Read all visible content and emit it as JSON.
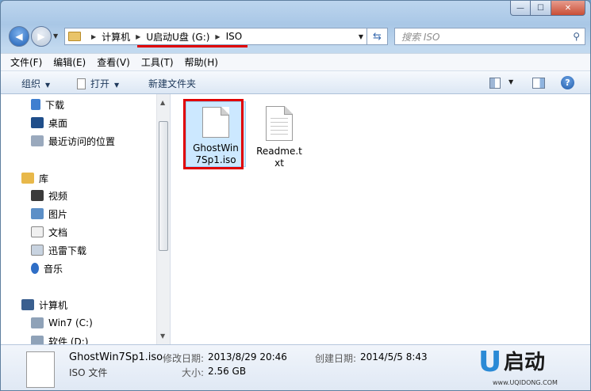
{
  "window": {
    "caption_min": "—",
    "caption_max": "☐",
    "caption_close": "✕"
  },
  "address": {
    "crumbs": [
      "计算机",
      "U启动U盘 (G:)",
      "ISO"
    ],
    "search_placeholder": "搜索 ISO"
  },
  "menu": [
    "文件(F)",
    "编辑(E)",
    "查看(V)",
    "工具(T)",
    "帮助(H)"
  ],
  "toolbar": {
    "organize": "组织",
    "open": "打开",
    "new_folder": "新建文件夹"
  },
  "nav": {
    "items": [
      {
        "label": "下载",
        "icon": "download-folder-icon"
      },
      {
        "label": "桌面",
        "icon": "desktop-icon"
      },
      {
        "label": "最近访问的位置",
        "icon": "recent-places-icon"
      },
      {
        "label": "库",
        "icon": "library-icon"
      },
      {
        "label": "视频",
        "icon": "video-library-icon"
      },
      {
        "label": "图片",
        "icon": "picture-library-icon"
      },
      {
        "label": "文档",
        "icon": "document-library-icon"
      },
      {
        "label": "迅雷下载",
        "icon": "thunder-download-icon"
      },
      {
        "label": "音乐",
        "icon": "music-library-icon"
      },
      {
        "label": "计算机",
        "icon": "computer-icon"
      },
      {
        "label": "Win7 (C:)",
        "icon": "drive-c-icon"
      },
      {
        "label": "软件 (D:)",
        "icon": "drive-d-icon"
      }
    ]
  },
  "files": [
    {
      "name": "GhostWin7Sp1.iso",
      "icon": "iso-file-icon"
    },
    {
      "name": "Readme.txt",
      "icon": "text-file-icon"
    }
  ],
  "details": {
    "name": "GhostWin7Sp1.iso",
    "type": "ISO 文件",
    "modified_label": "修改日期:",
    "modified_value": "2013/8/29 20:46",
    "created_label": "创建日期:",
    "created_value": "2014/5/5 8:43",
    "size_label": "大小:",
    "size_value": "2.56 GB"
  },
  "logo": {
    "letter": "U",
    "text": "启动",
    "url": "www.UQIDONG.COM"
  }
}
